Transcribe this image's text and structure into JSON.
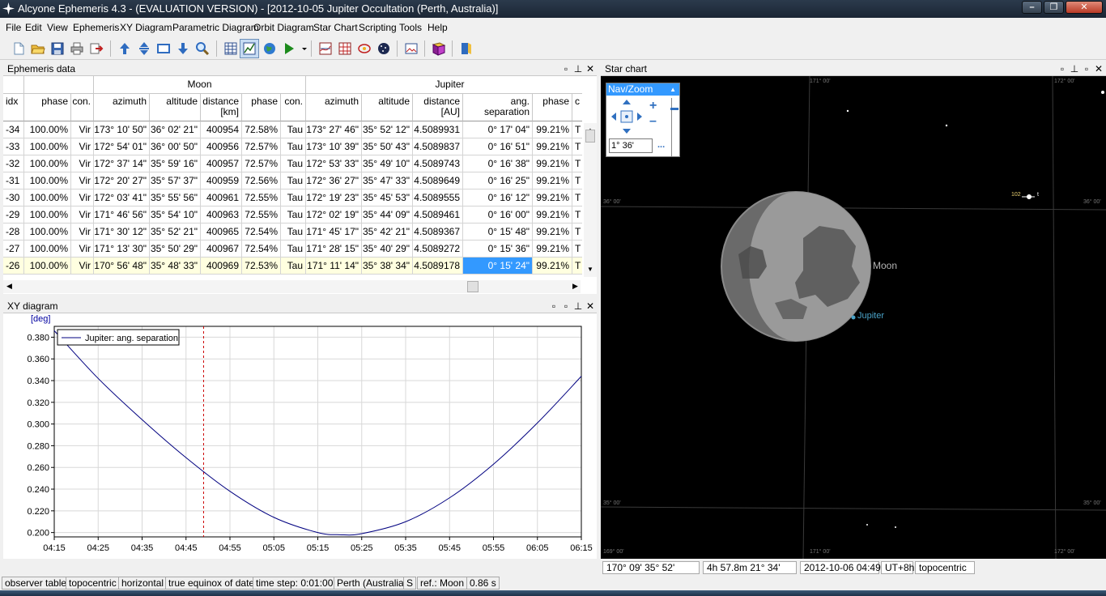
{
  "window": {
    "title": "Alcyone Ephemeris 4.3 - (EVALUATION VERSION) - [2012-10-05 Jupiter Occultation (Perth, Australia)]"
  },
  "menu": [
    "File",
    "Edit",
    "View",
    "Ephemeris",
    "XY Diagram",
    "Parametric Diagram",
    "Orbit Diagram",
    "Star Chart",
    "Scripting",
    "Tools",
    "Help"
  ],
  "ephemeris": {
    "title": "Ephemeris data",
    "groups": {
      "moon": "Moon",
      "jupiter": "Jupiter"
    },
    "columns": [
      "idx",
      "phase",
      "con.",
      "azimuth",
      "altitude",
      "distance\n[km]",
      "phase",
      "con.",
      "azimuth",
      "altitude",
      "distance\n[AU]",
      "ang. separation",
      "phase",
      "c"
    ],
    "rows": [
      [
        "-34",
        "100.00%",
        "Vir",
        "173° 10' 50\"",
        "36° 02' 21\"",
        "400954",
        "72.58%",
        "Tau",
        "173° 27' 46\"",
        "35° 52' 12\"",
        "4.5089931",
        "0° 17' 04\"",
        "99.21%",
        "T"
      ],
      [
        "-33",
        "100.00%",
        "Vir",
        "172° 54' 01\"",
        "36° 00' 50\"",
        "400956",
        "72.57%",
        "Tau",
        "173° 10' 39\"",
        "35° 50' 43\"",
        "4.5089837",
        "0° 16' 51\"",
        "99.21%",
        "T"
      ],
      [
        "-32",
        "100.00%",
        "Vir",
        "172° 37' 14\"",
        "35° 59' 16\"",
        "400957",
        "72.57%",
        "Tau",
        "172° 53' 33\"",
        "35° 49' 10\"",
        "4.5089743",
        "0° 16' 38\"",
        "99.21%",
        "T"
      ],
      [
        "-31",
        "100.00%",
        "Vir",
        "172° 20' 27\"",
        "35° 57' 37\"",
        "400959",
        "72.56%",
        "Tau",
        "172° 36' 27\"",
        "35° 47' 33\"",
        "4.5089649",
        "0° 16' 25\"",
        "99.21%",
        "T"
      ],
      [
        "-30",
        "100.00%",
        "Vir",
        "172° 03' 41\"",
        "35° 55' 56\"",
        "400961",
        "72.55%",
        "Tau",
        "172° 19' 23\"",
        "35° 45' 53\"",
        "4.5089555",
        "0° 16' 12\"",
        "99.21%",
        "T"
      ],
      [
        "-29",
        "100.00%",
        "Vir",
        "171° 46' 56\"",
        "35° 54' 10\"",
        "400963",
        "72.55%",
        "Tau",
        "172° 02' 19\"",
        "35° 44' 09\"",
        "4.5089461",
        "0° 16' 00\"",
        "99.21%",
        "T"
      ],
      [
        "-28",
        "100.00%",
        "Vir",
        "171° 30' 12\"",
        "35° 52' 21\"",
        "400965",
        "72.54%",
        "Tau",
        "171° 45' 17\"",
        "35° 42' 21\"",
        "4.5089367",
        "0° 15' 48\"",
        "99.21%",
        "T"
      ],
      [
        "-27",
        "100.00%",
        "Vir",
        "171° 13' 30\"",
        "35° 50' 29\"",
        "400967",
        "72.54%",
        "Tau",
        "171° 28' 15\"",
        "35° 40' 29\"",
        "4.5089272",
        "0° 15' 36\"",
        "99.21%",
        "T"
      ],
      [
        "-26",
        "100.00%",
        "Vir",
        "170° 56' 48\"",
        "35° 48' 33\"",
        "400969",
        "72.53%",
        "Tau",
        "171° 11' 14\"",
        "35° 38' 34\"",
        "4.5089178",
        "0° 15' 24\"",
        "99.21%",
        "T"
      ]
    ]
  },
  "xy_panel": {
    "title": "XY diagram"
  },
  "chart_data": {
    "type": "line",
    "ylabel": "[deg]",
    "legend": "top-left",
    "grid": true,
    "x_ticks": [
      "04:15",
      "04:25",
      "04:35",
      "04:45",
      "04:55",
      "05:05",
      "05:15",
      "05:25",
      "05:35",
      "05:45",
      "05:55",
      "06:05",
      "06:15"
    ],
    "y_ticks": [
      0.2,
      0.22,
      0.24,
      0.26,
      0.28,
      0.3,
      0.32,
      0.34,
      0.36,
      0.38
    ],
    "y_tick_labels": [
      "0.200",
      "0.220",
      "0.240",
      "0.260",
      "0.280",
      "0.300",
      "0.320",
      "0.340",
      "0.360",
      "0.380"
    ],
    "xlim": [
      "04:15",
      "06:15"
    ],
    "ylim": [
      0.196,
      0.39
    ],
    "marker_time": "04:49",
    "series": [
      {
        "name": "Jupiter: ang. separation",
        "color": "#000080",
        "x": [
          "04:15",
          "04:25",
          "04:35",
          "04:45",
          "04:55",
          "05:05",
          "05:15",
          "05:20",
          "05:25",
          "05:35",
          "05:45",
          "05:55",
          "06:05",
          "06:15"
        ],
        "y": [
          0.386,
          0.342,
          0.304,
          0.269,
          0.238,
          0.214,
          0.2,
          0.198,
          0.199,
          0.21,
          0.232,
          0.263,
          0.301,
          0.344
        ]
      }
    ]
  },
  "starchart": {
    "title": "Star chart",
    "nav_zoom": {
      "title": "Nav/Zoom",
      "fov": "1° 36'",
      "more": "..."
    },
    "grid_labels": [
      "171° 00'",
      "172° 00'",
      "36° 00'",
      "36° 00'",
      "35° 00'",
      "35° 00'",
      "169° 00'",
      "171° 00'",
      "172° 00'"
    ],
    "labels": {
      "moon": "Moon",
      "jupiter": "Jupiter",
      "star": "102",
      "star2": "t"
    },
    "status": [
      "170° 09'   35° 52'",
      "4h 57.8m   21° 34'",
      "2012-10-06  04:49",
      "UT+8h",
      "topocentric"
    ]
  },
  "statusbar": [
    "observer table",
    "topocentric",
    "horizontal",
    "true equinox of date",
    "time step: 0:01:00",
    "Perth (Australia)",
    "S",
    "ref.: Moon",
    "0.86 s"
  ],
  "colors": {
    "selection": "#3399ff",
    "highlight_row": "#ffffe0",
    "series": "#000080",
    "marker": "#cc0000",
    "jupiter_label": "#4aa3c8"
  }
}
